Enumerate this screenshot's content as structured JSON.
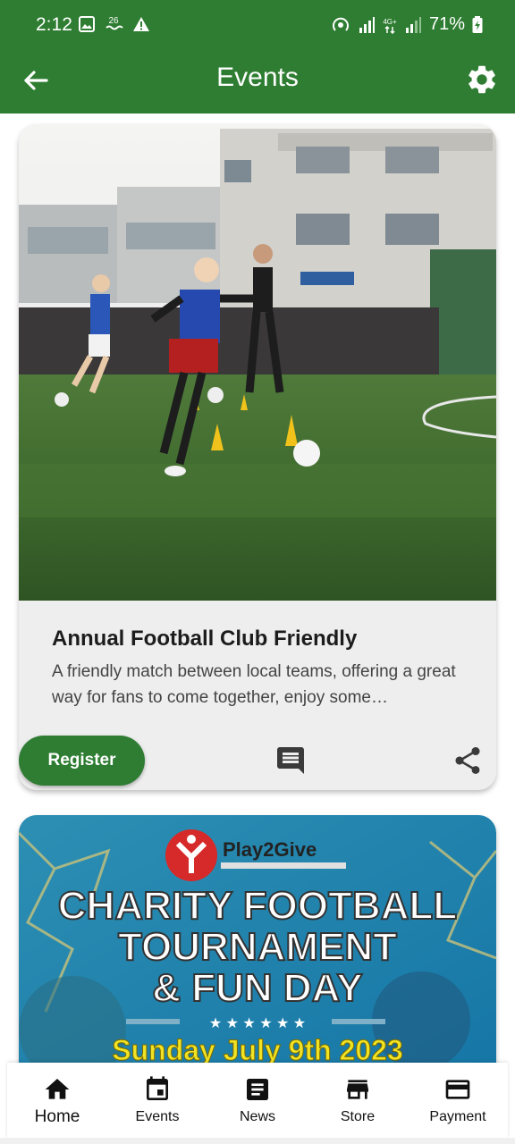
{
  "status_bar": {
    "time": "2:12",
    "notification_count": "26",
    "battery": "71%"
  },
  "app_bar": {
    "title": "Events"
  },
  "events": [
    {
      "title": "Annual Football Club Friendly",
      "description": "A friendly match between local teams, offering a great way for fans to come together, enjoy some…",
      "register_label": "Register"
    },
    {
      "banner_brand": "Play2Give",
      "banner_line1": "CHARITY FOOTBALL",
      "banner_line2": "TOURNAMENT",
      "banner_line3": "& FUN DAY",
      "banner_date": "Sunday July 9th 2023"
    }
  ],
  "bottom_nav": {
    "items": [
      {
        "label": "Home",
        "icon": "home-icon"
      },
      {
        "label": "Events",
        "icon": "calendar-icon"
      },
      {
        "label": "News",
        "icon": "news-icon"
      },
      {
        "label": "Store",
        "icon": "store-icon"
      },
      {
        "label": "Payment",
        "icon": "credit-card-icon"
      }
    ]
  },
  "colors": {
    "primary": "#2e7d32",
    "card_background": "#eeeeee",
    "banner_blue": "#1f8fb0",
    "banner_yellow": "#f1e324"
  }
}
